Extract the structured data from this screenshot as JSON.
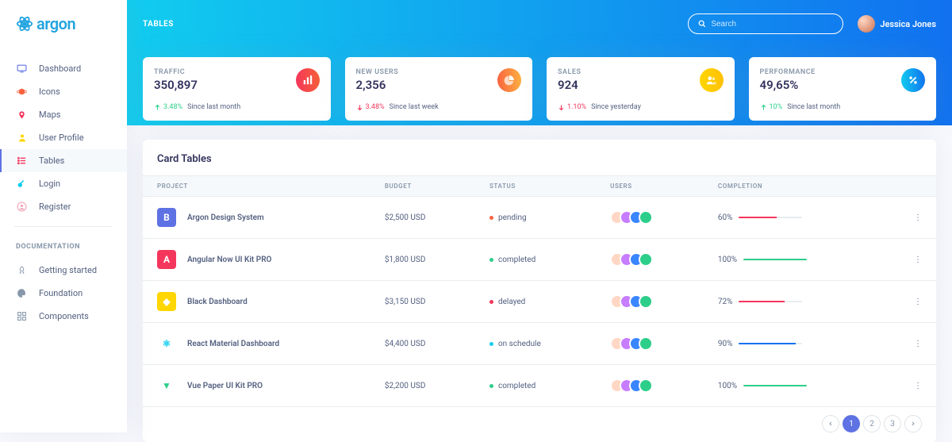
{
  "brand": {
    "name": "argon"
  },
  "breadcrumb": "TABLES",
  "search": {
    "placeholder": "Search"
  },
  "user": {
    "name": "Jessica Jones"
  },
  "sidebar": {
    "items": [
      {
        "label": "Dashboard",
        "icon": "tv-icon",
        "color": "#5e72e4"
      },
      {
        "label": "Icons",
        "icon": "planet-icon",
        "color": "#fb6340"
      },
      {
        "label": "Maps",
        "icon": "pin-icon",
        "color": "#f5365c"
      },
      {
        "label": "User Profile",
        "icon": "user-icon",
        "color": "#ffd600"
      },
      {
        "label": "Tables",
        "icon": "list-icon",
        "color": "#f5365c",
        "active": true
      },
      {
        "label": "Login",
        "icon": "key-icon",
        "color": "#11cdef"
      },
      {
        "label": "Register",
        "icon": "circle-user-icon",
        "color": "#f3a4b5"
      }
    ]
  },
  "docs": {
    "heading": "DOCUMENTATION",
    "items": [
      {
        "label": "Getting started",
        "icon": "rocket-icon"
      },
      {
        "label": "Foundation",
        "icon": "palette-icon"
      },
      {
        "label": "Components",
        "icon": "ui-icon"
      }
    ]
  },
  "stats": [
    {
      "title": "TRAFFIC",
      "value": "350,897",
      "trend": "up",
      "pct": "3.48%",
      "since": "Since last month",
      "iconClass": "bg-pink",
      "icon": "chart-bar-icon"
    },
    {
      "title": "NEW USERS",
      "value": "2,356",
      "trend": "down",
      "pct": "3.48%",
      "since": "Since last week",
      "iconClass": "bg-orange",
      "icon": "chart-pie-icon"
    },
    {
      "title": "SALES",
      "value": "924",
      "trend": "down",
      "pct": "1.10%",
      "since": "Since yesterday",
      "iconClass": "bg-yellow",
      "icon": "users-icon"
    },
    {
      "title": "PERFORMANCE",
      "value": "49,65%",
      "trend": "up",
      "pct": "10%",
      "since": "Since last month",
      "iconClass": "bg-cyan",
      "icon": "percent-icon"
    }
  ],
  "card": {
    "title": "Card Tables",
    "columns": [
      "PROJECT",
      "BUDGET",
      "STATUS",
      "USERS",
      "COMPLETION",
      ""
    ],
    "rows": [
      {
        "project": "Argon Design System",
        "logoBg": "#5e72e4",
        "logoFg": "#fff",
        "logoText": "B",
        "budget": "$2,500 USD",
        "status": "pending",
        "statusColor": "#fb6340",
        "completion": 60,
        "barColor": "#f5365c"
      },
      {
        "project": "Angular Now UI Kit PRO",
        "logoBg": "#f5365c",
        "logoFg": "#fff",
        "logoText": "A",
        "budget": "$1,800 USD",
        "status": "completed",
        "statusColor": "#2dce89",
        "completion": 100,
        "barColor": "#2dce89"
      },
      {
        "project": "Black Dashboard",
        "logoBg": "#ffd600",
        "logoFg": "#fff",
        "logoText": "◆",
        "budget": "$3,150 USD",
        "status": "delayed",
        "statusColor": "#f5365c",
        "completion": 72,
        "barColor": "#f5365c"
      },
      {
        "project": "React Material Dashboard",
        "logoBg": "#fff",
        "logoFg": "#11cdef",
        "logoText": "⚛",
        "budget": "$4,400 USD",
        "status": "on schedule",
        "statusColor": "#11cdef",
        "completion": 90,
        "barColor": "#1171ef"
      },
      {
        "project": "Vue Paper UI Kit PRO",
        "logoBg": "#fff",
        "logoFg": "#2dce89",
        "logoText": "▼",
        "budget": "$2,200 USD",
        "status": "completed",
        "statusColor": "#2dce89",
        "completion": 100,
        "barColor": "#2dce89"
      }
    ],
    "avatarColors": [
      "#ffd7c4",
      "#c77dff",
      "#3a86ff",
      "#2dce89"
    ]
  },
  "pagination": {
    "pages": [
      "1",
      "2",
      "3"
    ],
    "active": 0
  }
}
